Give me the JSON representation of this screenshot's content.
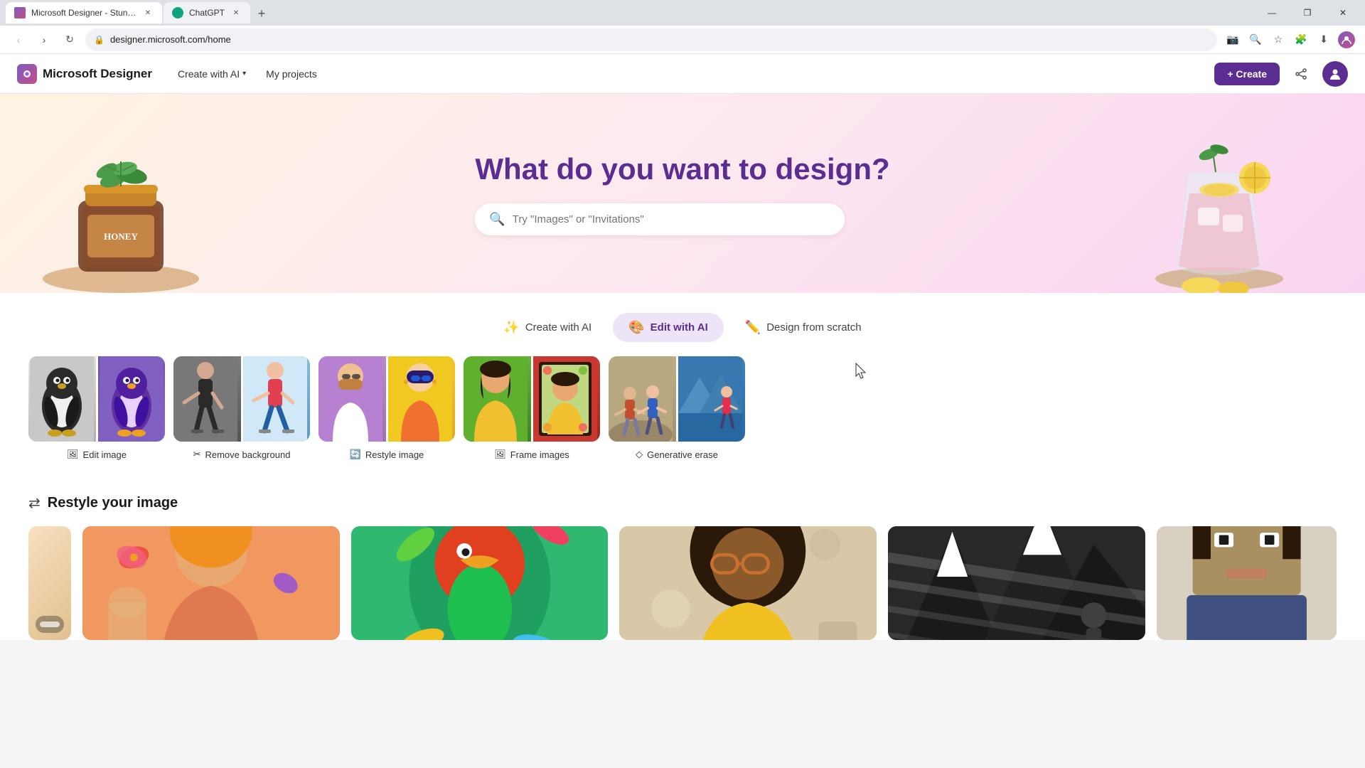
{
  "browser": {
    "tabs": [
      {
        "id": "designer",
        "favicon_color": "#7c5cbf",
        "title": "Microsoft Designer - Stunning...",
        "active": true
      },
      {
        "id": "chatgpt",
        "favicon_color": "#10a37f",
        "title": "ChatGPT",
        "active": false
      }
    ],
    "new_tab_label": "+",
    "address_bar": "designer.microsoft.com/home",
    "window_controls": [
      "—",
      "❐",
      "✕"
    ],
    "nav_buttons": {
      "back": "‹",
      "forward": "›",
      "refresh": "↻",
      "home": "⌂"
    },
    "toolbar_actions": {
      "screenshot": "📷",
      "zoom": "🔍",
      "bookmark": "☆",
      "extensions": "🧩",
      "download": "⬇",
      "profile": "👤"
    }
  },
  "app": {
    "logo_text": "Microsoft Designer",
    "nav_items": [
      {
        "id": "create-ai",
        "label": "Create with AI",
        "has_dropdown": true
      },
      {
        "id": "my-projects",
        "label": "My projects",
        "has_dropdown": false
      }
    ],
    "create_button": "+ Create",
    "header_icons": {
      "share": "🔗",
      "profile": "👤"
    }
  },
  "hero": {
    "title": "What do you want to design?",
    "search_placeholder": "Try \"Images\" or \"Invitations\""
  },
  "tabs": [
    {
      "id": "create-ai",
      "label": "Create with AI",
      "icon": "✨",
      "active": false
    },
    {
      "id": "edit-ai",
      "label": "Edit with AI",
      "icon": "🎨",
      "active": true
    },
    {
      "id": "design-scratch",
      "label": "Design from scratch",
      "icon": "🖊",
      "active": false
    }
  ],
  "edit_cards": [
    {
      "id": "edit-image",
      "label": "Edit image",
      "icon": "🖼"
    },
    {
      "id": "remove-bg",
      "label": "Remove background",
      "icon": "✂"
    },
    {
      "id": "restyle-image",
      "label": "Restyle image",
      "icon": "🔄"
    },
    {
      "id": "frame-images",
      "label": "Frame images",
      "icon": "🖼"
    },
    {
      "id": "generative-erase",
      "label": "Generative erase",
      "icon": "◇"
    }
  ],
  "restyle_section": {
    "icon": "↔",
    "title": "Restyle your image",
    "cards": [
      {
        "id": "restyle-1",
        "style": "restyle-card-1"
      },
      {
        "id": "restyle-2",
        "style": "restyle-card-2"
      },
      {
        "id": "restyle-3",
        "style": "restyle-card-3"
      },
      {
        "id": "restyle-4",
        "style": "restyle-card-4"
      },
      {
        "id": "restyle-5",
        "style": "restyle-card-5"
      }
    ]
  },
  "colors": {
    "brand_purple": "#5c2d91",
    "brand_gradient_start": "#7c5cbf",
    "brand_gradient_end": "#c44f8a",
    "hero_bg_start": "#fef3e2",
    "hero_bg_mid": "#fde8f0",
    "hero_bg_end": "#f9d4f0"
  }
}
